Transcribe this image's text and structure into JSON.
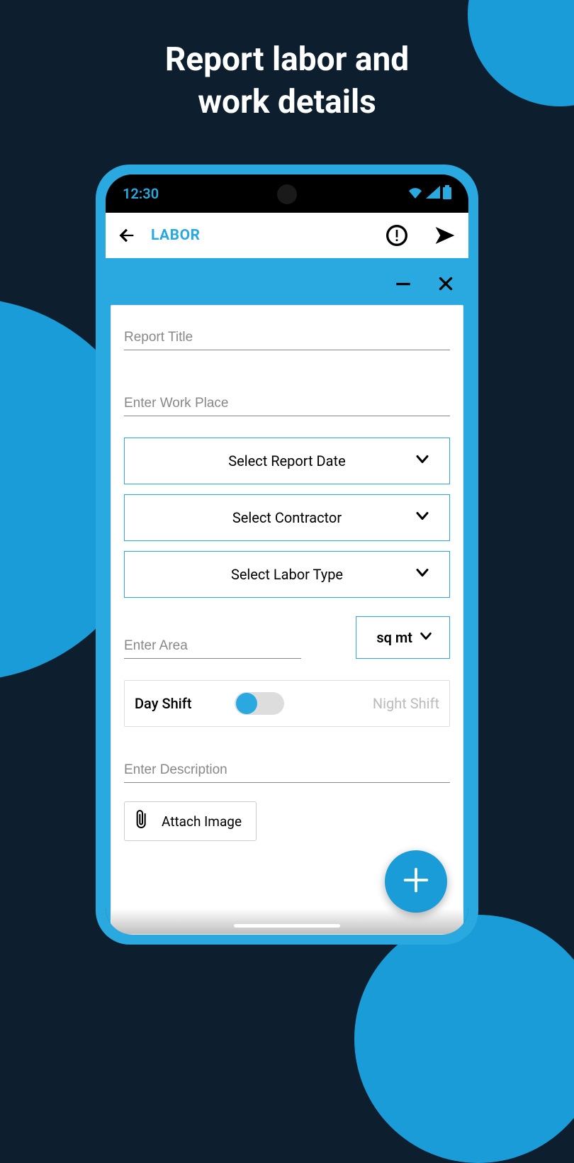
{
  "promo": {
    "line1": "Report labor and",
    "line2": "work details"
  },
  "status": {
    "time": "12:30"
  },
  "header": {
    "title": "LABOR"
  },
  "form": {
    "report_title_placeholder": "Report Title",
    "work_place_placeholder": "Enter Work Place",
    "select_date": "Select Report Date",
    "select_contractor": "Select Contractor",
    "select_labor_type": "Select Labor Type",
    "area_placeholder": "Enter Area",
    "unit_label": "sq mt",
    "shift_day": "Day Shift",
    "shift_night": "Night Shift",
    "description_placeholder": "Enter Description",
    "attach_label": "Attach Image"
  }
}
